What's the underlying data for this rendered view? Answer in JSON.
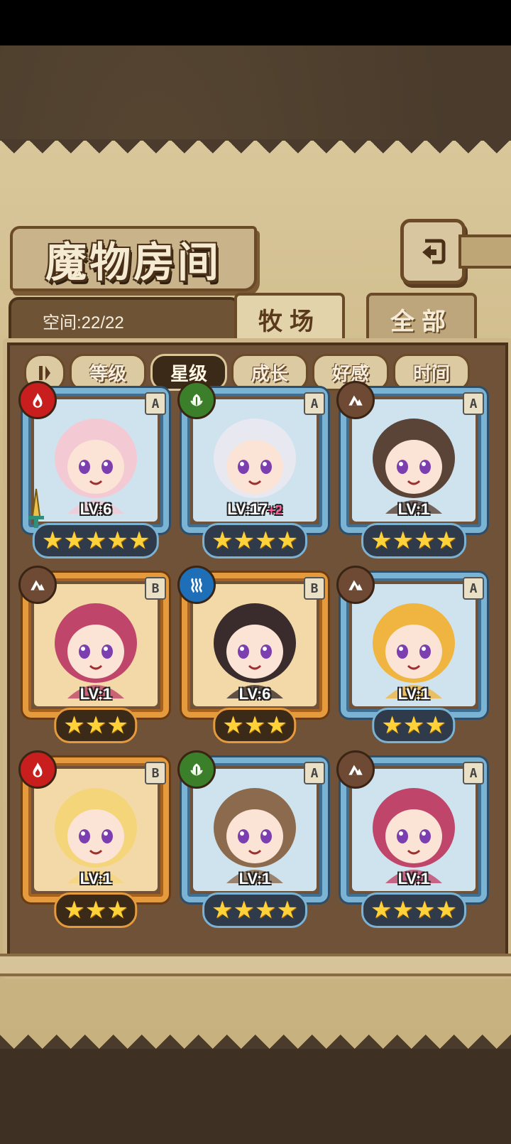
{
  "screen": {
    "title": "魔物房间",
    "capacity": "空间:22/22"
  },
  "tabs": [
    {
      "label": "牧场",
      "active": true
    },
    {
      "label": "全部",
      "active": false
    }
  ],
  "sort_buttons": [
    {
      "label": "等级",
      "active": false
    },
    {
      "label": "星级",
      "active": true
    },
    {
      "label": "成长",
      "active": false
    },
    {
      "label": "好感",
      "active": false
    },
    {
      "label": "时间",
      "active": false
    }
  ],
  "monsters": [
    {
      "lv": "LV:6",
      "plus": "",
      "rank": "A",
      "element": "fire",
      "stars": "★★★★★",
      "frame": "blue",
      "portrait_color": "#f3c9d4"
    },
    {
      "lv": "LV:17",
      "plus": "+2",
      "rank": "A",
      "element": "leaf",
      "stars": "★★★★",
      "frame": "blue",
      "portrait_color": "#e8e8f0"
    },
    {
      "lv": "LV:1",
      "plus": "",
      "rank": "A",
      "element": "earth",
      "stars": "★★★★",
      "frame": "blue",
      "portrait_color": "#5a4437"
    },
    {
      "lv": "LV:1",
      "plus": "",
      "rank": "B",
      "element": "earth",
      "stars": "★★★",
      "frame": "gold",
      "portrait_color": "#c0456a"
    },
    {
      "lv": "LV:6",
      "plus": "",
      "rank": "B",
      "element": "water",
      "stars": "★★★",
      "frame": "gold",
      "portrait_color": "#3a2c2c"
    },
    {
      "lv": "LV:1",
      "plus": "",
      "rank": "A",
      "element": "earth",
      "stars": "★★★",
      "frame": "blue",
      "portrait_color": "#f0b540"
    },
    {
      "lv": "LV:1",
      "plus": "",
      "rank": "B",
      "element": "fire",
      "stars": "★★★",
      "frame": "gold",
      "portrait_color": "#f4d57a"
    },
    {
      "lv": "LV:1",
      "plus": "",
      "rank": "A",
      "element": "leaf",
      "stars": "★★★★",
      "frame": "blue",
      "portrait_color": "#8b6a4e"
    },
    {
      "lv": "LV:1",
      "plus": "",
      "rank": "A",
      "element": "earth",
      "stars": "★★★★",
      "frame": "blue",
      "portrait_color": "#c0456a"
    }
  ],
  "element_colors": {
    "fire": "#c81e1e",
    "leaf": "#3b7f2a",
    "earth": "#6e4a35",
    "water": "#1f6fb8"
  },
  "icons": {
    "back": "return-arrow-icon",
    "sort_toggle": "sort-order-icon"
  }
}
